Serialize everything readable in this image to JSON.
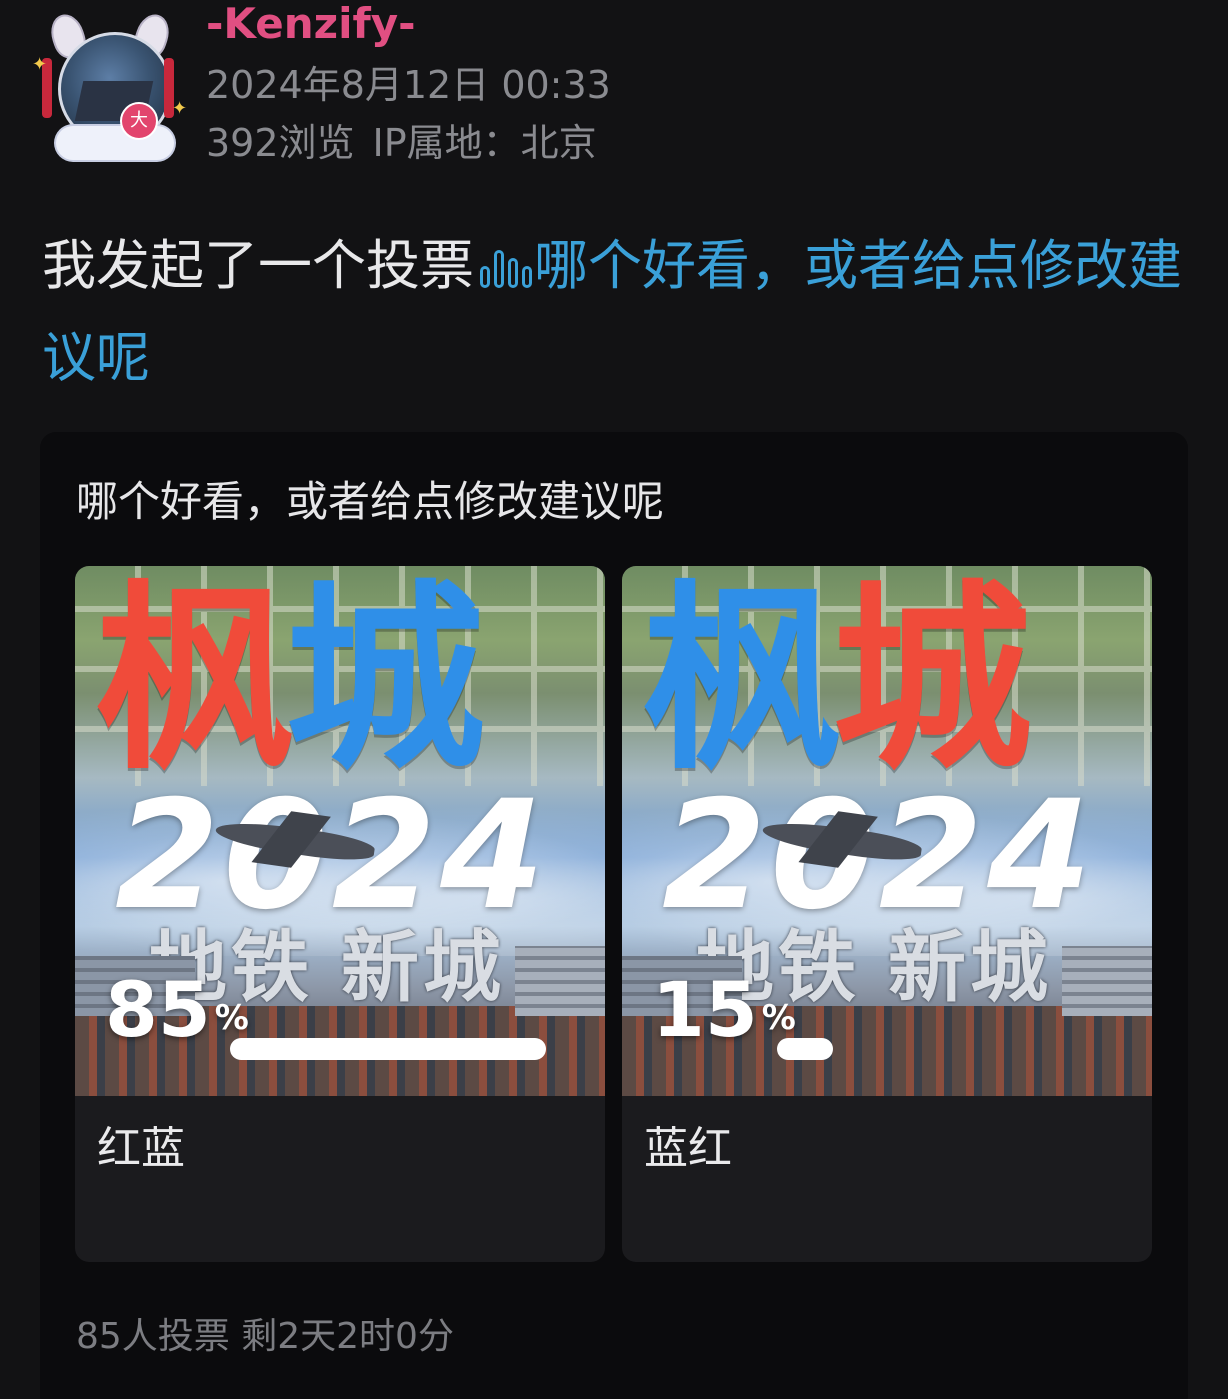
{
  "user": {
    "name": "-Kenzify-",
    "avatar_badge": "大",
    "datetime": "2024年8月12日 00:33",
    "views": "392浏览",
    "ip_location": "IP属地：北京"
  },
  "post": {
    "prefix": "我发起了一个投票",
    "poll_icon": "poll-bars-icon",
    "link_text": "哪个好看，或者给点修改建议呢"
  },
  "poll": {
    "question": "哪个好看，或者给点修改建议呢",
    "options": [
      {
        "label": "红蓝",
        "percent": 85,
        "percent_text": "85",
        "percent_symbol": "%",
        "image": {
          "title_chars": [
            "枫",
            "城"
          ],
          "title_colors": [
            "#f04b3a",
            "#2f8fe8"
          ],
          "year": "2024",
          "subtitle_a": "地铁",
          "subtitle_b": "新城"
        }
      },
      {
        "label": "蓝红",
        "percent": 15,
        "percent_text": "15",
        "percent_symbol": "%",
        "image": {
          "title_chars": [
            "枫",
            "城"
          ],
          "title_colors": [
            "#2f8fe8",
            "#f04b3a"
          ],
          "year": "2024",
          "subtitle_a": "地铁",
          "subtitle_b": "新城"
        }
      }
    ],
    "footer": "85人投票 剩2天2时0分"
  },
  "colors": {
    "background": "#121214",
    "username": "#e14f82",
    "link": "#3aa0d8",
    "card": "#0b0b0d",
    "option_card": "#1b1b1e"
  }
}
